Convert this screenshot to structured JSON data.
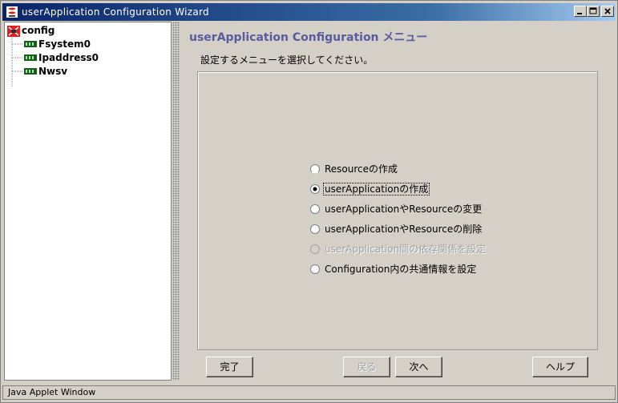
{
  "window": {
    "title": "userApplication Configuration Wizard",
    "controls": {
      "minimize": "minimize-icon",
      "maximize": "maximize-icon",
      "close": "close-icon"
    }
  },
  "tree": {
    "root": {
      "label": "config",
      "icon": "config-icon"
    },
    "children": [
      {
        "label": "Fsystem0",
        "icon": "resource-icon"
      },
      {
        "label": "Ipaddress0",
        "icon": "resource-icon"
      },
      {
        "label": "Nwsv",
        "icon": "resource-icon"
      }
    ]
  },
  "main": {
    "heading": "userApplication Configuration メニュー",
    "instruction": "設定するメニューを選択してください。",
    "options": [
      {
        "label": "Resourceの作成",
        "selected": false,
        "enabled": true
      },
      {
        "label": "userApplicationの作成",
        "selected": true,
        "enabled": true
      },
      {
        "label": "userApplicationやResourceの変更",
        "selected": false,
        "enabled": true
      },
      {
        "label": "userApplicationやResourceの削除",
        "selected": false,
        "enabled": true
      },
      {
        "label": "userApplication間の依存関係を設定",
        "selected": false,
        "enabled": false
      },
      {
        "label": "Configuration内の共通情報を設定",
        "selected": false,
        "enabled": true
      }
    ]
  },
  "buttons": {
    "finish": "完了",
    "back": "戻る",
    "next": "次へ",
    "help": "ヘルプ"
  },
  "status": "Java Applet Window"
}
